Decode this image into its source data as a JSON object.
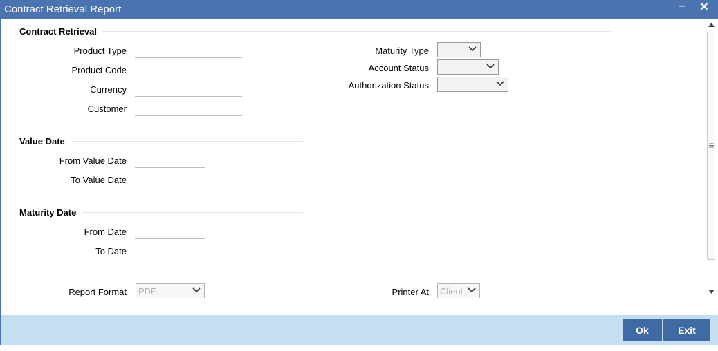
{
  "window": {
    "title": "Contract Retrieval Report",
    "minimize_label": "–",
    "close_label": "✕"
  },
  "sections": {
    "contract_retrieval": {
      "title": "Contract Retrieval",
      "product_type_label": "Product Type",
      "product_code_label": "Product Code",
      "currency_label": "Currency",
      "customer_label": "Customer",
      "maturity_type_label": "Maturity Type",
      "account_status_label": "Account Status",
      "authorization_status_label": "Authorization Status"
    },
    "value_date": {
      "title": "Value Date",
      "from_label": "From Value Date",
      "to_label": "To Value Date"
    },
    "maturity_date": {
      "title": "Maturity Date",
      "from_label": "From Date",
      "to_label": "To Date"
    }
  },
  "report": {
    "format_label": "Report Format",
    "format_value": "PDF",
    "printer_label": "Printer At",
    "printer_value": "Client"
  },
  "footer": {
    "ok_label": "Ok",
    "exit_label": "Exit"
  },
  "icons": {
    "dropdown": "chevron-down-icon",
    "scroll_up": "arrow-up-icon",
    "scroll_down": "arrow-down-icon"
  }
}
